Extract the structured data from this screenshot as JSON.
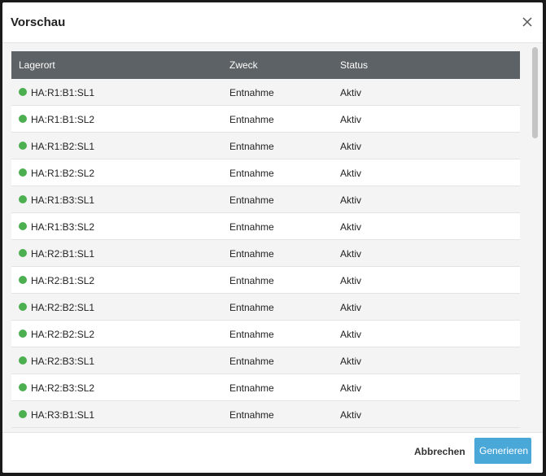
{
  "dialog": {
    "title": "Vorschau",
    "close_icon": "close-icon"
  },
  "table": {
    "columns": [
      "Lagerort",
      "Zweck",
      "Status"
    ],
    "rows": [
      {
        "location": "HA:R1:B1:SL1",
        "purpose": "Entnahme",
        "status": "Aktiv"
      },
      {
        "location": "HA:R1:B1:SL2",
        "purpose": "Entnahme",
        "status": "Aktiv"
      },
      {
        "location": "HA:R1:B2:SL1",
        "purpose": "Entnahme",
        "status": "Aktiv"
      },
      {
        "location": "HA:R1:B2:SL2",
        "purpose": "Entnahme",
        "status": "Aktiv"
      },
      {
        "location": "HA:R1:B3:SL1",
        "purpose": "Entnahme",
        "status": "Aktiv"
      },
      {
        "location": "HA:R1:B3:SL2",
        "purpose": "Entnahme",
        "status": "Aktiv"
      },
      {
        "location": "HA:R2:B1:SL1",
        "purpose": "Entnahme",
        "status": "Aktiv"
      },
      {
        "location": "HA:R2:B1:SL2",
        "purpose": "Entnahme",
        "status": "Aktiv"
      },
      {
        "location": "HA:R2:B2:SL1",
        "purpose": "Entnahme",
        "status": "Aktiv"
      },
      {
        "location": "HA:R2:B2:SL2",
        "purpose": "Entnahme",
        "status": "Aktiv"
      },
      {
        "location": "HA:R2:B3:SL1",
        "purpose": "Entnahme",
        "status": "Aktiv"
      },
      {
        "location": "HA:R2:B3:SL2",
        "purpose": "Entnahme",
        "status": "Aktiv"
      },
      {
        "location": "HA:R3:B1:SL1",
        "purpose": "Entnahme",
        "status": "Aktiv"
      }
    ]
  },
  "footer": {
    "cancel_label": "Abbrechen",
    "generate_label": "Generieren"
  },
  "colors": {
    "status_dot": "#4caf50",
    "header_bg": "#5c6266",
    "primary_button": "#4aa8d8"
  }
}
